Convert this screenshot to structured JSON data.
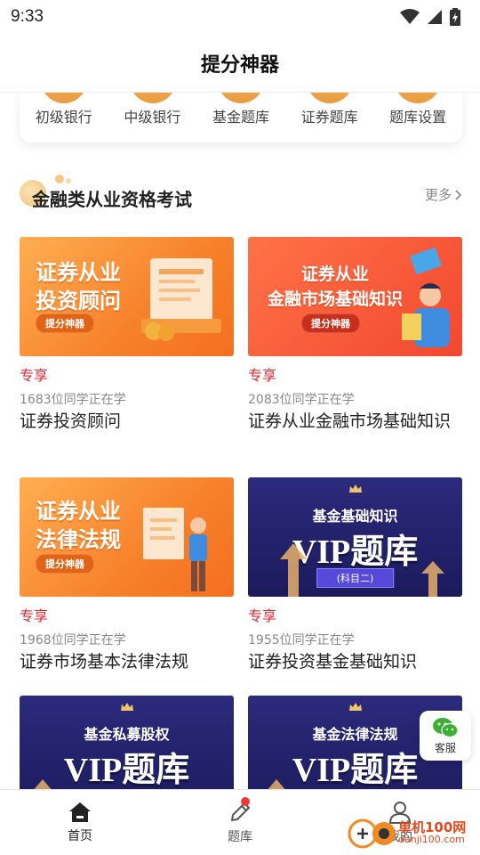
{
  "status_bar": {
    "time": "9:33"
  },
  "header": {
    "title": "提分神器"
  },
  "shortcuts": [
    {
      "label": "初级银行"
    },
    {
      "label": "中级银行"
    },
    {
      "label": "基金题库"
    },
    {
      "label": "证券题库"
    },
    {
      "label": "题库设置"
    }
  ],
  "section": {
    "title": "金融类从业资格考试",
    "more": "更多"
  },
  "courses": [
    {
      "banner_line1": "证券从业",
      "banner_line2": "投资顾问",
      "brand": "提分神器",
      "tag": "专享",
      "learners": "1683位同学正在学",
      "name": "证券投资顾问"
    },
    {
      "banner_line1": "证券从业",
      "banner_line2": "金融市场基础知识",
      "brand": "提分神器",
      "tag": "专享",
      "learners": "2083位同学正在学",
      "name": "证券从业金融市场基础知识"
    },
    {
      "banner_line1": "证券从业",
      "banner_line2": "法律法规",
      "brand": "提分神器",
      "tag": "专享",
      "learners": "1968位同学正在学",
      "name": "证券市场基本法律法规"
    },
    {
      "vip_sub": "基金基础知识",
      "vip_main": "VIP题库",
      "vip_pill": "(科目二)",
      "tag": "专享",
      "learners": "1955位同学正在学",
      "name": "证券投资基金基础知识"
    },
    {
      "vip_sub": "基金私募股权",
      "vip_main": "VIP题库"
    },
    {
      "vip_sub": "基金法律法规",
      "vip_main": "VIP题库"
    }
  ],
  "service": {
    "label": "客服"
  },
  "tabs": [
    {
      "label": "首页"
    },
    {
      "label": "题库"
    },
    {
      "label": "我的"
    }
  ],
  "watermark": {
    "name": "单机100网",
    "url": "danji100.com"
  },
  "colors": {
    "accent_red": "#e0262c",
    "orange": "#f7812b",
    "vip_navy": "#2c2a7c"
  }
}
